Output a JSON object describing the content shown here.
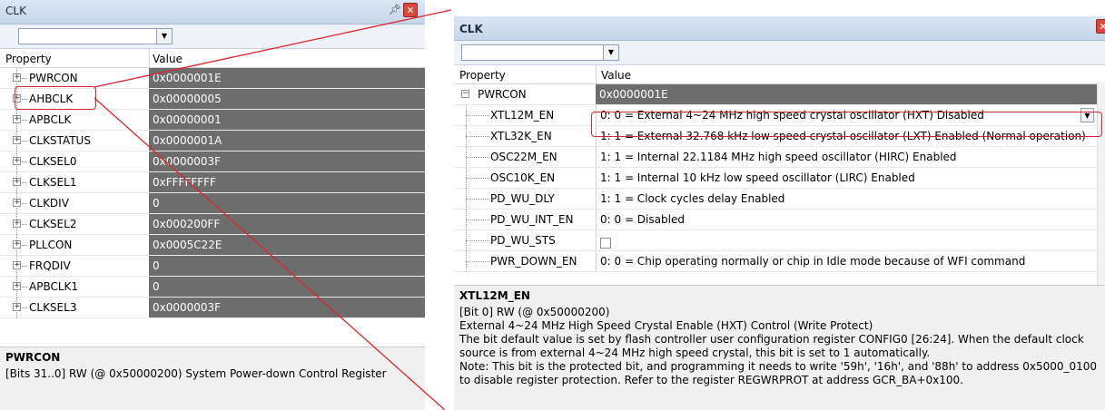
{
  "left": {
    "title": "CLK",
    "pin_icon": "pin-icon",
    "close_icon": "close-icon",
    "header": {
      "property": "Property",
      "value": "Value"
    },
    "rows": [
      {
        "name": "PWRCON",
        "value": "0x0000001E"
      },
      {
        "name": "AHBCLK",
        "value": "0x00000005"
      },
      {
        "name": "APBCLK",
        "value": "0x00000001"
      },
      {
        "name": "CLKSTATUS",
        "value": "0x0000001A"
      },
      {
        "name": "CLKSEL0",
        "value": "0x0000003F"
      },
      {
        "name": "CLKSEL1",
        "value": "0xFFFFFFFF"
      },
      {
        "name": "CLKDIV",
        "value": "0"
      },
      {
        "name": "CLKSEL2",
        "value": "0x000200FF"
      },
      {
        "name": "PLLCON",
        "value": "0x0005C22E"
      },
      {
        "name": "FRQDIV",
        "value": "0"
      },
      {
        "name": "APBCLK1",
        "value": "0"
      },
      {
        "name": "CLKSEL3",
        "value": "0x0000003F"
      }
    ],
    "description": {
      "title": "PWRCON",
      "text": "[Bits 31..0] RW (@ 0x50000200) System Power-down Control Register"
    }
  },
  "right": {
    "title": "CLK",
    "close_icon": "close-icon",
    "header": {
      "property": "Property",
      "value": "Value"
    },
    "parent": {
      "name": "PWRCON",
      "value": "0x0000001E"
    },
    "children": [
      {
        "name": "XTL12M_EN",
        "value": "0: 0 = External 4~24 MHz high speed crystal oscillator (HXT) Disabled"
      },
      {
        "name": "XTL32K_EN",
        "value": "1: 1 = External 32.768 kHz low speed crystal oscillator (LXT) Enabled (Normal operation)"
      },
      {
        "name": "OSC22M_EN",
        "value": "1: 1 = Internal 22.1184 MHz high speed oscillator (HIRC) Enabled"
      },
      {
        "name": "OSC10K_EN",
        "value": "1: 1 = Internal 10 kHz low speed oscillator (LIRC) Enabled"
      },
      {
        "name": "PD_WU_DLY",
        "value": "1: 1 = Clock cycles delay Enabled"
      },
      {
        "name": "PD_WU_INT_EN",
        "value": "0: 0 = Disabled"
      },
      {
        "name": "PD_WU_STS",
        "value": ""
      },
      {
        "name": "PWR_DOWN_EN",
        "value": "0: 0 = Chip operating normally or chip in Idle mode because of WFI command"
      }
    ],
    "description": {
      "title": "XTL12M_EN",
      "line1": "[Bit 0] RW (@ 0x50000200)",
      "line2": "External 4~24 MHz High Speed Crystal Enable (HXT) Control (Write Protect)",
      "line3": "The bit default value is set by flash controller user configuration register CONFIG0 [26:24]. When the default clock",
      "line4": "source is from external 4~24 MHz high speed crystal, this bit is set to 1 automatically.",
      "line5": "Note: This bit is the protected bit, and programming it needs to write '59h', '16h', and '88h' to address 0x5000_0100",
      "line6": "to disable register protection. Refer to the register REGWRPROT at address GCR_BA+0x100."
    }
  },
  "colors": {
    "annotation": "#d8262d",
    "dark_value_bg": "#6d6d6d"
  }
}
